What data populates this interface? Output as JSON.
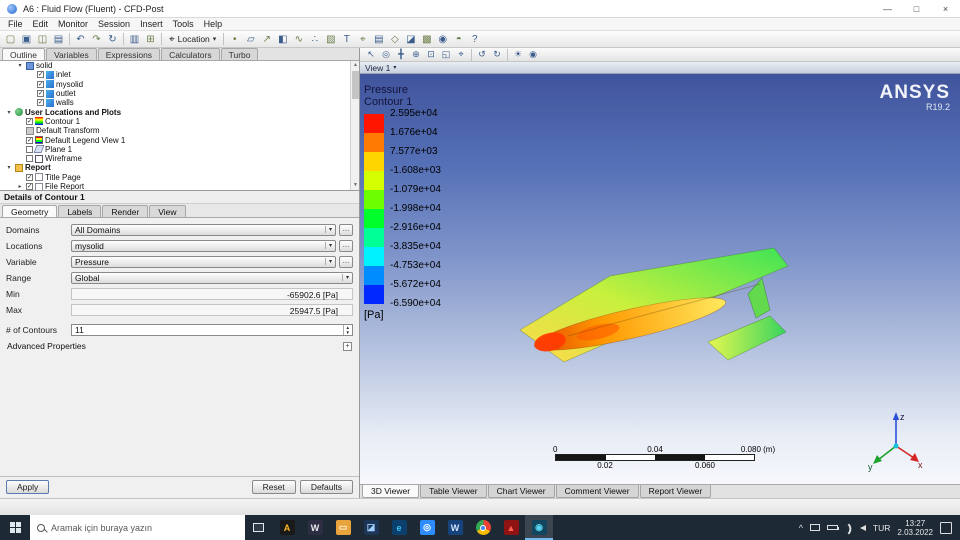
{
  "window": {
    "title": "A6 : Fluid Flow (Fluent) - CFD-Post",
    "minimize_glyph": "—",
    "maximize_glyph": "□",
    "close_glyph": "×"
  },
  "menu": {
    "items": [
      "File",
      "Edit",
      "Monitor",
      "Session",
      "Insert",
      "Tools",
      "Help"
    ]
  },
  "main_toolbar": {
    "icons": [
      {
        "name": "new-file-icon",
        "glyph": "▢"
      },
      {
        "name": "open-file-icon",
        "glyph": "▣"
      },
      {
        "name": "save-icon",
        "glyph": "◫"
      },
      {
        "name": "report-icon",
        "glyph": "▤"
      },
      {
        "sep": true
      },
      {
        "name": "undo-icon",
        "glyph": "↶"
      },
      {
        "name": "redo-icon",
        "glyph": "↷"
      },
      {
        "name": "refresh-icon",
        "glyph": "↻"
      },
      {
        "sep": true
      },
      {
        "name": "chart-icon",
        "glyph": "▥"
      },
      {
        "name": "calculator-icon",
        "glyph": "⊞"
      },
      {
        "sep": true
      },
      {
        "name": "location-dropdown",
        "glyph": "⌖",
        "label": "Location",
        "caret": "▾"
      },
      {
        "sep": true
      },
      {
        "name": "point-icon",
        "glyph": "•"
      },
      {
        "name": "plane-icon",
        "glyph": "▱"
      },
      {
        "name": "vector-icon",
        "glyph": "↗"
      },
      {
        "name": "contour-icon",
        "glyph": "◧"
      },
      {
        "name": "streamline-icon",
        "glyph": "∿"
      },
      {
        "name": "particle-track-icon",
        "glyph": "∴"
      },
      {
        "name": "volume-rendering-icon",
        "glyph": "▨"
      },
      {
        "name": "text-label-icon",
        "glyph": "T"
      },
      {
        "name": "coord-frame-icon",
        "glyph": "⌖"
      },
      {
        "name": "legend-icon",
        "glyph": "▤"
      },
      {
        "name": "instance-transform-icon",
        "glyph": "◇"
      },
      {
        "name": "clip-plane-icon",
        "glyph": "◪"
      },
      {
        "name": "color-map-icon",
        "glyph": "▩"
      },
      {
        "name": "camera-icon",
        "glyph": "◉"
      },
      {
        "name": "viewport-layout-icon",
        "glyph": "◓"
      },
      {
        "name": "help-icon",
        "glyph": "?"
      }
    ]
  },
  "left_panel": {
    "tabs": [
      {
        "label": "Outline",
        "active": true
      },
      {
        "label": "Variables"
      },
      {
        "label": "Expressions"
      },
      {
        "label": "Calculators"
      },
      {
        "label": "Turbo"
      }
    ],
    "tree": [
      {
        "label": "solid",
        "depth": 1,
        "twisty": "open",
        "icon": "mesh"
      },
      {
        "label": "inlet",
        "depth": 2,
        "check": true,
        "icon": "boundary"
      },
      {
        "label": "mysolid",
        "depth": 2,
        "check": true,
        "icon": "boundary"
      },
      {
        "label": "outlet",
        "depth": 2,
        "check": true,
        "icon": "boundary"
      },
      {
        "label": "walls",
        "depth": 2,
        "check": true,
        "icon": "boundary"
      },
      {
        "label": "User Locations and Plots",
        "depth": 0,
        "twisty": "open",
        "icon": "group",
        "bold": true
      },
      {
        "label": "Contour 1",
        "depth": 1,
        "check": true,
        "icon": "contour"
      },
      {
        "label": "Default Transform",
        "depth": 1,
        "icon": "transform"
      },
      {
        "label": "Default Legend View 1",
        "depth": 1,
        "check": true,
        "icon": "legend"
      },
      {
        "label": "Plane 1",
        "depth": 1,
        "check": false,
        "icon": "plane"
      },
      {
        "label": "Wireframe",
        "depth": 1,
        "check": false,
        "icon": "wireframe"
      },
      {
        "label": "Report",
        "depth": 0,
        "twisty": "open",
        "icon": "report",
        "bold": true
      },
      {
        "label": "Title Page",
        "depth": 1,
        "check": true,
        "icon": "page"
      },
      {
        "label": "File Report",
        "depth": 1,
        "check": true,
        "twisty": "closed",
        "icon": "page"
      }
    ],
    "details_title": "Details of Contour 1",
    "details_tabs": [
      {
        "label": "Geometry",
        "active": true
      },
      {
        "label": "Labels"
      },
      {
        "label": "Render"
      },
      {
        "label": "View"
      }
    ],
    "fields": [
      {
        "label": "Domains",
        "value": "All Domains",
        "type": "select",
        "more": true
      },
      {
        "label": "Locations",
        "value": "mysolid",
        "type": "select",
        "more": true
      },
      {
        "label": "Variable",
        "value": "Pressure",
        "type": "select",
        "more": true
      },
      {
        "label": "Range",
        "value": "Global",
        "type": "select"
      },
      {
        "label": "Min",
        "value": "-65902.6 [Pa]",
        "type": "readonly"
      },
      {
        "label": "Max",
        "value": "25947.5 [Pa]",
        "type": "readonly"
      },
      {
        "label": "# of Contours",
        "value": "11",
        "type": "spinner"
      }
    ],
    "advanced_label": "Advanced Properties",
    "apply_label": "Apply",
    "reset_label": "Reset",
    "defaults_label": "Defaults"
  },
  "viewer": {
    "toolbar_icons": [
      {
        "name": "select-arrow-icon",
        "glyph": "↖"
      },
      {
        "name": "orbit-icon",
        "glyph": "◎"
      },
      {
        "name": "pan-icon",
        "glyph": "╋"
      },
      {
        "name": "zoom-icon",
        "glyph": "⊕"
      },
      {
        "name": "zoom-box-icon",
        "glyph": "⊡"
      },
      {
        "name": "fit-view-icon",
        "glyph": "◱"
      },
      {
        "name": "center-icon",
        "glyph": "⌖"
      },
      {
        "sep": true
      },
      {
        "name": "rotate-left-icon",
        "glyph": "↺"
      },
      {
        "name": "rotate-right-icon",
        "glyph": "↻"
      },
      {
        "sep": true
      },
      {
        "name": "light-icon",
        "glyph": "☀"
      },
      {
        "name": "snapshot-icon",
        "glyph": "◉"
      }
    ],
    "view_tab_label": "View 1",
    "view_tab_caret": "▾",
    "legend": {
      "title_line1": "Pressure",
      "title_line2": "Contour 1",
      "unit": "[Pa]",
      "values": [
        "2.595e+04",
        "1.676e+04",
        "7.577e+03",
        "-1.608e+03",
        "-1.079e+04",
        "-1.998e+04",
        "-2.916e+04",
        "-3.835e+04",
        "-4.753e+04",
        "-5.672e+04",
        "-6.590e+04"
      ],
      "band_colors": [
        "#ff1500",
        "#ff7a00",
        "#ffd500",
        "#d4ff00",
        "#6bff00",
        "#00ff2a",
        "#00ff96",
        "#00f2ff",
        "#008cff",
        "#0029ff"
      ]
    },
    "brand_name": "ANSYS",
    "brand_version": "R19.2",
    "scale_bar": {
      "top_labels": [
        "0",
        "0.04",
        "0.080 (m)"
      ],
      "bottom_labels": [
        "0.02",
        "0.060"
      ]
    },
    "axes": {
      "x": "x",
      "y": "y",
      "z": "z"
    },
    "bottom_tabs": [
      {
        "label": "3D Viewer",
        "active": true
      },
      {
        "label": "Table Viewer"
      },
      {
        "label": "Chart Viewer"
      },
      {
        "label": "Comment Viewer"
      },
      {
        "label": "Report Viewer"
      }
    ]
  },
  "taskbar": {
    "search_placeholder": "Aramak için buraya yazın",
    "apps": [
      {
        "name": "taskbar-app-ansys-launcher",
        "glyph": "A",
        "bg": "#1a1a1a",
        "fg": "#ffb71b"
      },
      {
        "name": "taskbar-app-workbench",
        "glyph": "W",
        "bg": "#2d2d44",
        "fg": "#e8e8e8"
      },
      {
        "name": "taskbar-app-file-explorer",
        "glyph": "▭",
        "bg": "#e8a33d",
        "fg": "#fff3d0"
      },
      {
        "name": "taskbar-app-photos",
        "glyph": "◪",
        "bg": "#1d3557",
        "fg": "#9fd0ff"
      },
      {
        "name": "taskbar-app-edge",
        "glyph": "e",
        "bg": "#0a3f6e",
        "fg": "#35c1f1"
      },
      {
        "name": "taskbar-app-zoom",
        "glyph": "◎",
        "bg": "#2d8cff",
        "fg": "#ffffff"
      },
      {
        "name": "taskbar-app-word",
        "glyph": "W",
        "bg": "#17437c",
        "fg": "#cfe3ff"
      },
      {
        "name": "taskbar-app-chrome",
        "glyph": "",
        "bg": "chrome",
        "fg": ""
      },
      {
        "name": "taskbar-app-acrobat",
        "glyph": "▲",
        "bg": "#8f1313",
        "fg": "#ff5f56"
      },
      {
        "name": "taskbar-app-cfd-post",
        "glyph": "◉",
        "bg": "#12455e",
        "fg": "#59d3f0",
        "active": true
      }
    ],
    "tray_language": "TUR",
    "tray_time": "13:27",
    "tray_date": "2.03.2022"
  }
}
